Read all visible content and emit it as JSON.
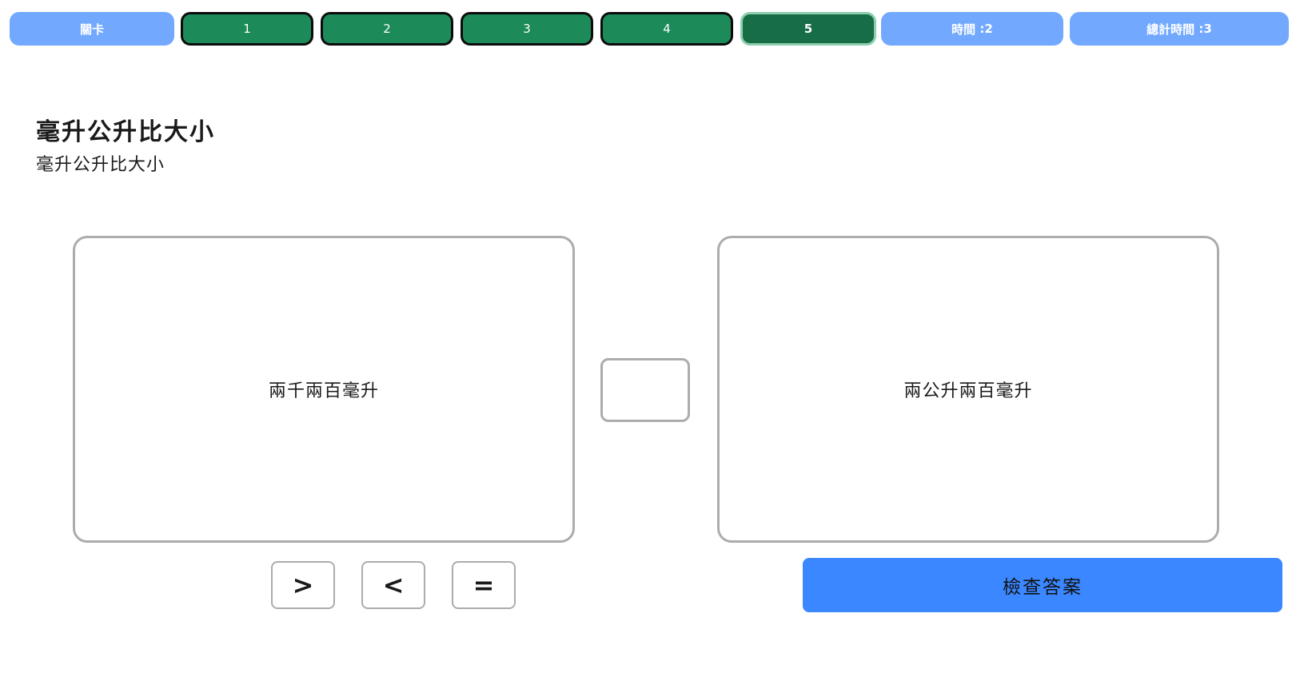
{
  "topbar": {
    "level_label": "關卡",
    "levels": [
      {
        "label": "1",
        "active": false
      },
      {
        "label": "2",
        "active": false
      },
      {
        "label": "3",
        "active": false
      },
      {
        "label": "4",
        "active": false
      },
      {
        "label": "5",
        "active": true
      }
    ],
    "time_label": "時間",
    "time_value": "2",
    "total_time_label": "總計時間",
    "total_time_value": "3"
  },
  "heading": {
    "title": "毫升公升比大小",
    "subtitle": "毫升公升比大小"
  },
  "comparison": {
    "left_value": "兩千兩百毫升",
    "answer": "",
    "right_value": "兩公升兩百毫升"
  },
  "operators": {
    "greater": ">",
    "less": "<",
    "equal": "="
  },
  "check_button": "檢查答案",
  "colors": {
    "info_pill": "#72a9ff",
    "level_pill": "#1c8a59",
    "level_active": "#166d46",
    "check_button": "#3b87ff",
    "card_border": "#acacac"
  }
}
